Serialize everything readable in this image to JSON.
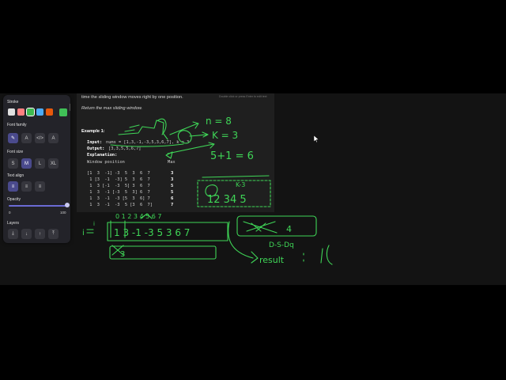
{
  "problem": {
    "line1": "time the sliding window moves right by one position.",
    "line2": "Return the max sliding window.",
    "example_title": "Example 1:",
    "input_label": "Input:",
    "input_value": "nums = [1,3,-1,-3,5,3,6,7], k = 3",
    "output_label": "Output:",
    "output_value": "[3,3,5,5,6,7]",
    "explanation_label": "Explanation:",
    "window_header": "Window position",
    "max_header": "Max",
    "rows": [
      {
        "window": "[1  3  -1] -3  5  3  6  7",
        "max": "3"
      },
      {
        "window": " 1 [3  -1  -3] 5  3  6  7",
        "max": "3"
      },
      {
        "window": " 1  3 [-1  -3  5] 3  6  7",
        "max": "5"
      },
      {
        "window": " 1  3  -1 [-3  5  3] 6  7",
        "max": "5"
      },
      {
        "window": " 1  3  -1  -3 [5  3  6] 7",
        "max": "6"
      },
      {
        "window": " 1  3  -1  -3  5 [3  6  7]",
        "max": "7"
      }
    ]
  },
  "hint": "Double click or press Enter to edit text",
  "toolbar": {
    "stroke_label": "Stroke",
    "stroke_colors": [
      "#e0e0e0",
      "#ff8080",
      "#3fb950",
      "#4dabf7",
      "#e8590c",
      "#40c057"
    ],
    "font_family_label": "Font family",
    "font_size_label": "Font size",
    "font_sizes": [
      "S",
      "M",
      "L",
      "XL"
    ],
    "text_align_label": "Text align",
    "opacity_label": "Opacity",
    "opacity_min": "0",
    "opacity_max": "100",
    "opacity_value": 100,
    "layers_label": "Layers"
  },
  "ink_notes": {
    "n": "n = 8",
    "k": "K = 3",
    "count": "5+1 = 6",
    "result_label": "result",
    "deque_label": "D-S-Dq",
    "box_value": "3"
  }
}
